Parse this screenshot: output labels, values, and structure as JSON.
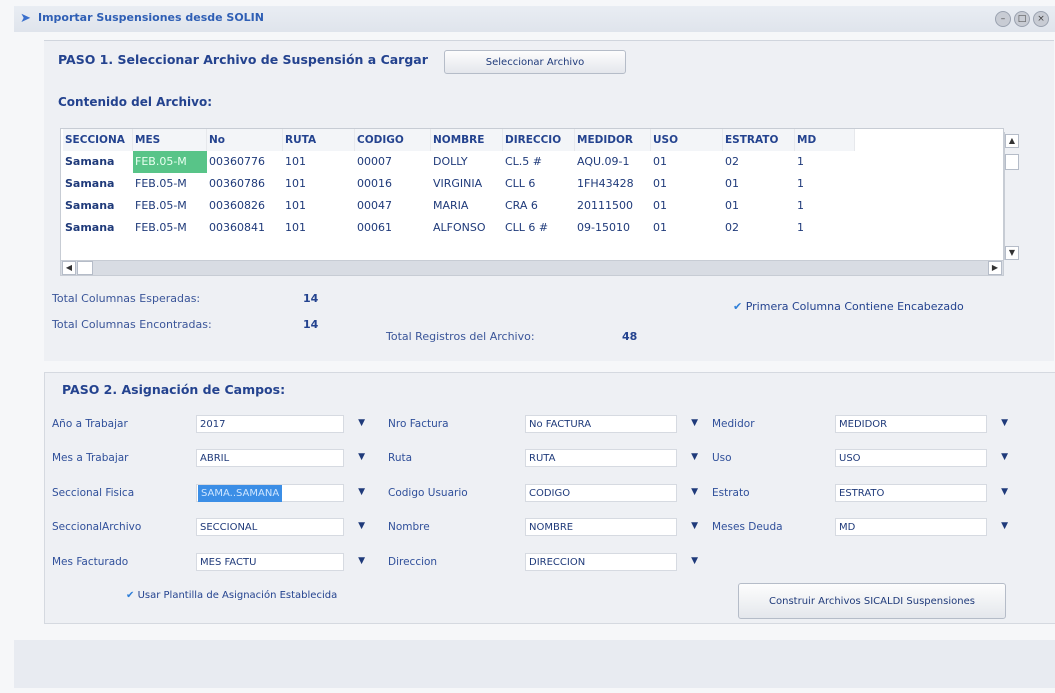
{
  "window": {
    "title": "Importar Suspensiones desde SOLIN"
  },
  "step1": {
    "title": "PASO 1. Seleccionar Archivo de Suspensión a Cargar",
    "select_button": "Seleccionar Archivo",
    "content_label": "Contenido del Archivo:"
  },
  "table": {
    "columns": [
      "SECCIONA",
      "MES",
      "No",
      "RUTA",
      "CODIGO",
      "NOMBRE",
      "DIRECCIO",
      "MEDIDOR",
      "USO",
      "ESTRATO",
      "MD"
    ],
    "rows": [
      [
        "Samana",
        "FEB.05-M",
        "00360776",
        "101",
        "00007",
        "DOLLY",
        "CL.5 #",
        "AQU.09-1",
        "01",
        "02",
        "1"
      ],
      [
        "Samana",
        "FEB.05-M",
        "00360786",
        "101",
        "00016",
        "VIRGINIA",
        "CLL 6",
        "1FH43428",
        "01",
        "01",
        "1"
      ],
      [
        "Samana",
        "FEB.05-M",
        "00360826",
        "101",
        "00047",
        "MARIA",
        "CRA 6",
        "20111500",
        "01",
        "01",
        "1"
      ],
      [
        "Samana",
        "FEB.05-M",
        "00360841",
        "101",
        "00061",
        "ALFONSO",
        "CLL 6 #",
        "09-15010",
        "01",
        "02",
        "1"
      ]
    ]
  },
  "stats": {
    "expected_label": "Total Columnas Esperadas:",
    "expected_value": "14",
    "found_label": "Total Columnas Encontradas:",
    "found_value": "14",
    "records_label": "Total Registros del Archivo:",
    "records_value": "48",
    "header_check": "Primera Columna Contiene Encabezado"
  },
  "step2": {
    "title": "PASO 2. Asignación de Campos:",
    "fields": {
      "col1": [
        {
          "label": "Año a Trabajar",
          "value": "2017"
        },
        {
          "label": "Mes a Trabajar",
          "value": "ABRIL"
        },
        {
          "label": "Seccional Fisica",
          "value": "SAMA..SAMANA"
        },
        {
          "label": "SeccionalArchivo",
          "value": "SECCIONAL"
        },
        {
          "label": "Mes Facturado",
          "value": "MES FACTU"
        }
      ],
      "col2": [
        {
          "label": "Nro Factura",
          "value": "No FACTURA"
        },
        {
          "label": "Ruta",
          "value": "RUTA"
        },
        {
          "label": "Codigo Usuario",
          "value": "CODIGO"
        },
        {
          "label": "Nombre",
          "value": "NOMBRE"
        },
        {
          "label": "Direccion",
          "value": "DIRECCION"
        }
      ],
      "col3": [
        {
          "label": "Medidor",
          "value": "MEDIDOR"
        },
        {
          "label": "Uso",
          "value": "USO"
        },
        {
          "label": "Estrato",
          "value": "ESTRATO"
        },
        {
          "label": "Meses Deuda",
          "value": "MD"
        }
      ]
    },
    "template_check": "Usar Plantilla de Asignación Establecida",
    "build_button": "Construir Archivos SICALDI Suspensiones"
  }
}
